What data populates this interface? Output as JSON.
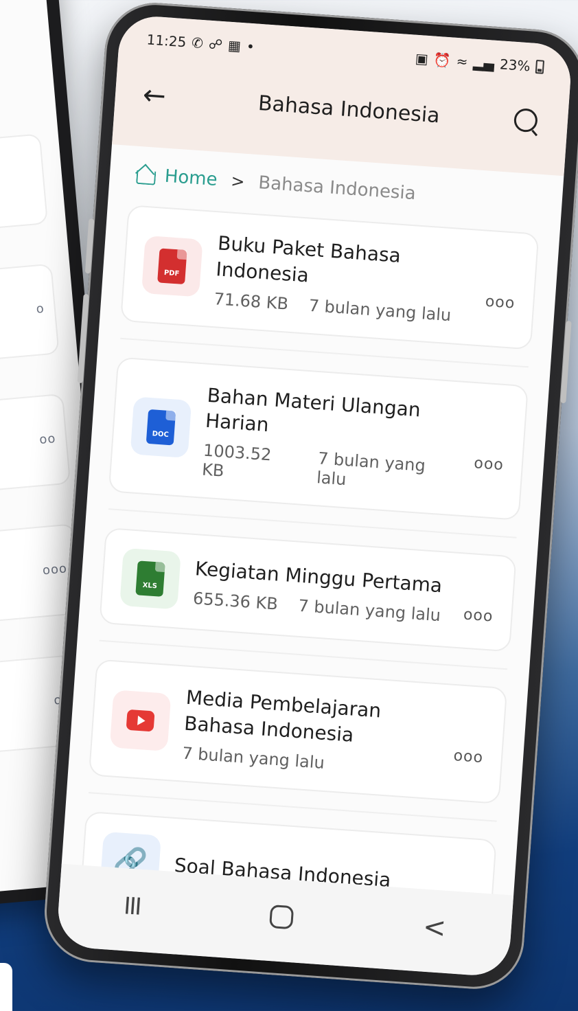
{
  "status_bar": {
    "time": "11:25",
    "left_icons": [
      "whatsapp-icon",
      "link-app-icon",
      "app-icon"
    ],
    "battery": "23%",
    "right_icons": [
      "lock-icon",
      "alarm-icon",
      "wifi-icon",
      "signal-icon"
    ]
  },
  "app_bar": {
    "title": "Bahasa Indonesia",
    "back_icon": "back-arrow-icon",
    "search_icon": "search-icon"
  },
  "breadcrumb": {
    "home": "Home",
    "separator": ">",
    "current": "Bahasa Indonesia"
  },
  "files": [
    {
      "title": "Buku Paket Bahasa Indonesia",
      "size": "71.68 KB",
      "date": "7 bulan yang lalu",
      "type": "PDF",
      "color": "#d32f2f",
      "bg": "#fbe9e9"
    },
    {
      "title": "Bahan Materi Ulangan Harian",
      "size": "1003.52 KB",
      "date": "7 bulan yang lalu",
      "type": "DOC",
      "color": "#1e5fd6",
      "bg": "#e8f0fc"
    },
    {
      "title": "Kegiatan Minggu Pertama",
      "size": "655.36 KB",
      "date": "7 bulan yang lalu",
      "type": "XLS",
      "color": "#2e7d32",
      "bg": "#e9f5ea"
    },
    {
      "title": "Media Pembelajaran Bahasa Indonesia",
      "size": "",
      "date": "7 bulan yang lalu",
      "type": "youtube",
      "color": "#e53935",
      "bg": "#fdecec"
    },
    {
      "title": "Soal Bahasa Indonesia",
      "size": "",
      "date": "",
      "type": "link",
      "color": "#1e5fd6",
      "bg": "#e8f0fc"
    }
  ],
  "more_label": "ooo",
  "nav": {
    "recent": "III",
    "back": "<"
  }
}
